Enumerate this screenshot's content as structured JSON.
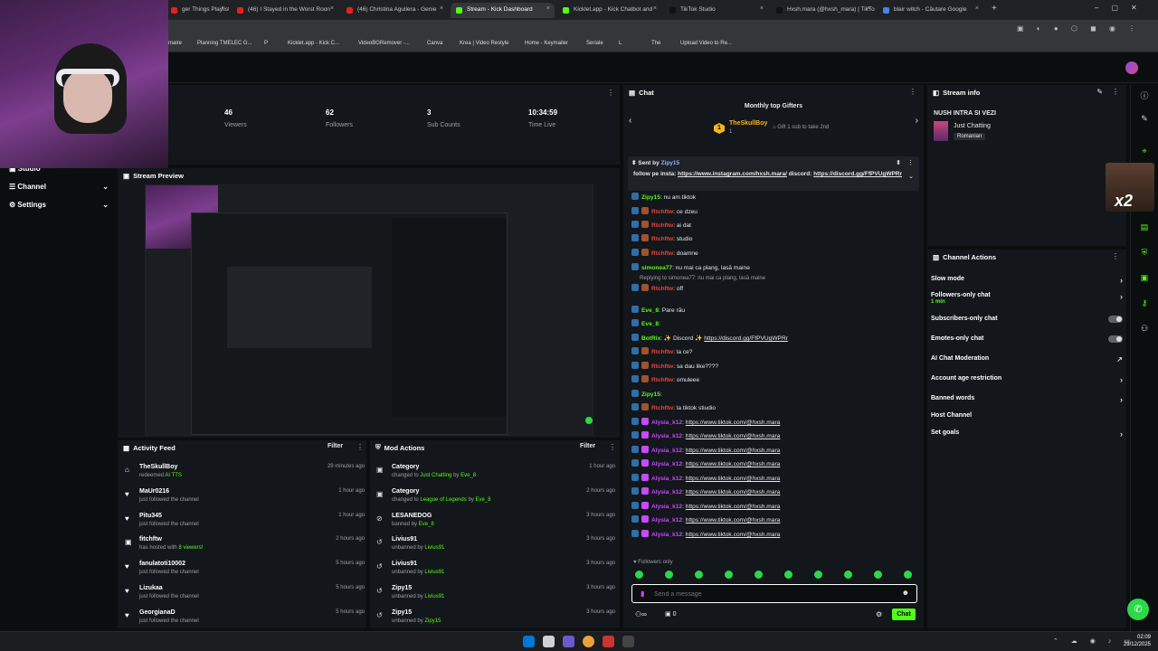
{
  "browser": {
    "tabs": [
      {
        "label": "ger Things Playlist |",
        "fav": "#e62117"
      },
      {
        "label": "(46) I Stayed in the Worst Roon",
        "fav": "#e62117"
      },
      {
        "label": "(46) Christina Aguilera - Genie",
        "fav": "#e62117"
      },
      {
        "label": "Stream - Kick Dashboard",
        "fav": "#53fc18"
      },
      {
        "label": "Kicklet.app - Kick Chatbot and",
        "fav": "#53fc18"
      },
      {
        "label": "TikTok Studio",
        "fav": "#111111"
      },
      {
        "label": "Hxsh.mara (@hxsh_mara) | TikTo",
        "fav": "#111111"
      },
      {
        "label": "blair witch - Căutare Google",
        "fav": "#4285f4"
      }
    ],
    "bookmarks": [
      "maire",
      "Planning TMELEC G...",
      "P",
      "Kicklet.app - Kick C...",
      "VideoBGRemover -...",
      "Canva",
      "Krea | Video Restyle",
      "Home - Keymailer",
      "Seriale",
      "L",
      "The",
      "Upload Video to Re..."
    ]
  },
  "stats": [
    {
      "value": "46",
      "label": "Viewers"
    },
    {
      "value": "62",
      "label": "Followers"
    },
    {
      "value": "3",
      "label": "Sub Counts"
    },
    {
      "value": "10:34:59",
      "label": "Time Live"
    }
  ],
  "sidebar": {
    "items": [
      {
        "label": "Studio",
        "icon": "studio-icon"
      },
      {
        "label": "Channel",
        "icon": "channel-icon"
      },
      {
        "label": "Settings",
        "icon": "gear-icon"
      }
    ]
  },
  "preview": {
    "title": "Stream Preview"
  },
  "activity": {
    "title": "Activity Feed",
    "filter": "Filter",
    "rows": [
      {
        "name": "TheSkullBoy",
        "desc": "redeemed",
        "extra": "AI TTS",
        "time": "29 minutes ago",
        "icon": "gift-icon"
      },
      {
        "name": "MaUr0216",
        "desc": "just followed the channel",
        "extra": "",
        "time": "1 hour ago",
        "icon": "heart-icon"
      },
      {
        "name": "Pitu345",
        "desc": "just followed the channel",
        "extra": "",
        "time": "1 hour ago",
        "icon": "heart-icon"
      },
      {
        "name": "fitchftw",
        "desc": "has hosted with",
        "extra": "8 viewers!",
        "time": "2 hours ago",
        "icon": "host-icon"
      },
      {
        "name": "fanulatoti10002",
        "desc": "just followed the channel",
        "extra": "",
        "time": "5 hours ago",
        "icon": "heart-icon"
      },
      {
        "name": "Lizukaa",
        "desc": "just followed the channel",
        "extra": "",
        "time": "5 hours ago",
        "icon": "heart-icon"
      },
      {
        "name": "GeorgianaD",
        "desc": "just followed the channel",
        "extra": "",
        "time": "5 hours ago",
        "icon": "heart-icon"
      }
    ]
  },
  "mod": {
    "title": "Mod Actions",
    "filter": "Filter",
    "rows": [
      {
        "name": "Category",
        "desc": "changed to",
        "target": "Just Chatting",
        "by": "by",
        "who": "Eve_8",
        "time": "1 hour ago",
        "icon": "category-icon"
      },
      {
        "name": "Category",
        "desc": "changed to",
        "target": "League of Legends",
        "by": "by",
        "who": "Eve_8",
        "time": "2 hours ago",
        "icon": "category-icon"
      },
      {
        "name": "LESANEDOG",
        "desc": "banned by",
        "target": "Eve_8",
        "by": "",
        "who": "",
        "time": "3 hours ago",
        "icon": "ban-icon"
      },
      {
        "name": "Livius91",
        "desc": "unbanned by",
        "target": "Livius91",
        "by": "",
        "who": "",
        "time": "3 hours ago",
        "icon": "unban-icon"
      },
      {
        "name": "Livius91",
        "desc": "unbanned by",
        "target": "Livius91",
        "by": "",
        "who": "",
        "time": "3 hours ago",
        "icon": "unban-icon"
      },
      {
        "name": "Zipy15",
        "desc": "unbanned by",
        "target": "Livius91",
        "by": "",
        "who": "",
        "time": "3 hours ago",
        "icon": "unban-icon"
      },
      {
        "name": "Zipy15",
        "desc": "unbanned by",
        "target": "Zipy15",
        "by": "",
        "who": "",
        "time": "3 hours ago",
        "icon": "unban-icon"
      }
    ]
  },
  "chat": {
    "title": "Chat",
    "gifters_title": "Monthly top Gifters",
    "gifter_rank": "1",
    "gifter_name": "TheSkullBoy",
    "gifter_count": "1",
    "gifter_hint": "Gift 1 sub to take 2nd",
    "pinned_by": "Sent by",
    "pinned_user": "Zipy15",
    "pinned_text": "follow pe insta:",
    "pinned_link": "https://www.instagram.com/hxsh.mara/",
    "pinned_mid": "discord:",
    "pinned_link2": "https://discord.gg/FfPVUgWPRr",
    "messages": [
      {
        "user": "Zipy15",
        "color": "#53fc18",
        "text": ": nu am tiktok",
        "link": ""
      },
      {
        "user": "Rtchftw",
        "color": "#e8463a",
        "text": ": ce dzeu",
        "link": ""
      },
      {
        "user": "Rtchftw",
        "color": "#e8463a",
        "text": ": ai dat",
        "link": ""
      },
      {
        "user": "Rtchftw",
        "color": "#e8463a",
        "text": ": studio",
        "link": ""
      },
      {
        "user": "Rtchftw",
        "color": "#e8463a",
        "text": ": doamne",
        "link": ""
      },
      {
        "user": "simonea77",
        "color": "#53fc18",
        "text": ": nu mai ca plang, lasă maine",
        "link": ""
      },
      {
        "user": "Rtchftw",
        "color": "#e8463a",
        "text": ": off",
        "link": ""
      },
      {
        "user": "Eve_8",
        "color": "#53fc18",
        "text": ": Pare rău",
        "link": ""
      },
      {
        "user": "Eve_8",
        "color": "#53fc18",
        "text": ":",
        "link": ""
      },
      {
        "user": "BotRix",
        "color": "#53fc18",
        "text": ": ✨ Discord ✨",
        "link": "https://discord.gg/FfPVUgWPRr"
      },
      {
        "user": "Rtchftw",
        "color": "#e8463a",
        "text": ": la ce?",
        "link": ""
      },
      {
        "user": "Rtchftw",
        "color": "#e8463a",
        "text": ": sa dau like????",
        "link": ""
      },
      {
        "user": "Rtchftw",
        "color": "#e8463a",
        "text": ": omuleee",
        "link": ""
      },
      {
        "user": "Zipy15",
        "color": "#53fc18",
        "text": ":",
        "link": ""
      },
      {
        "user": "Rtchftw",
        "color": "#e8463a",
        "text": ": la tiktok stiudio",
        "link": ""
      },
      {
        "user": "Alysia_k12",
        "color": "#c64bff",
        "text": ":",
        "link": "https://www.tiktok.com/@hxsh.mara"
      },
      {
        "user": "Alysia_k12",
        "color": "#c64bff",
        "text": ":",
        "link": "https://www.tiktok.com/@hxsh.mara"
      },
      {
        "user": "Alysia_k12",
        "color": "#c64bff",
        "text": ":",
        "link": "https://www.tiktok.com/@hxsh.mara"
      },
      {
        "user": "Alysia_k12",
        "color": "#c64bff",
        "text": ":",
        "link": "https://www.tiktok.com/@hxsh.mara"
      },
      {
        "user": "Alysia_k12",
        "color": "#c64bff",
        "text": ":",
        "link": "https://www.tiktok.com/@hxsh.mara"
      },
      {
        "user": "Alysia_k12",
        "color": "#c64bff",
        "text": ":",
        "link": "https://www.tiktok.com/@hxsh.mara"
      },
      {
        "user": "Alysia_k12",
        "color": "#c64bff",
        "text": ":",
        "link": "https://www.tiktok.com/@hxsh.mara"
      },
      {
        "user": "Alysia_k12",
        "color": "#c64bff",
        "text": ":",
        "link": "https://www.tiktok.com/@hxsh.mara"
      },
      {
        "user": "Alysia_k12",
        "color": "#c64bff",
        "text": ":",
        "link": "https://www.tiktok.com/@hxsh.mara"
      }
    ],
    "reply_note": "Replying to simonea77: nu mai ca plang, lasă maine",
    "followers_only": "Followers only",
    "input_placeholder": "Send a message",
    "count": "0",
    "send_label": "Chat"
  },
  "streaminfo": {
    "title": "Stream info",
    "stream_title": "NUSH INTRA SI VEZI",
    "category": "Just Chatting",
    "tag": "Romanian"
  },
  "actions": {
    "title": "Channel Actions",
    "items": [
      {
        "label": "Slow mode",
        "sub": "",
        "kind": "chevron"
      },
      {
        "label": "Followers-only chat",
        "sub": "1 min",
        "kind": "chevron"
      },
      {
        "label": "Subscribers-only chat",
        "sub": "",
        "kind": "toggle"
      },
      {
        "label": "Emotes-only chat",
        "sub": "",
        "kind": "toggle"
      },
      {
        "label": "AI Chat Moderation",
        "sub": "",
        "kind": "external"
      },
      {
        "label": "Account age restriction",
        "sub": "",
        "kind": "chevron"
      },
      {
        "label": "Banned words",
        "sub": "",
        "kind": "chevron"
      },
      {
        "label": "Host Channel",
        "sub": "",
        "kind": "none"
      },
      {
        "label": "Set goals",
        "sub": "",
        "kind": "chevron"
      }
    ]
  },
  "overlay": {
    "label": "x2"
  },
  "taskbar": {
    "time": "02:09",
    "date": "29/12/2025"
  },
  "colors": {
    "accent": "#53fc18",
    "bg": "#0b0e0f",
    "panel": "#13161a"
  }
}
